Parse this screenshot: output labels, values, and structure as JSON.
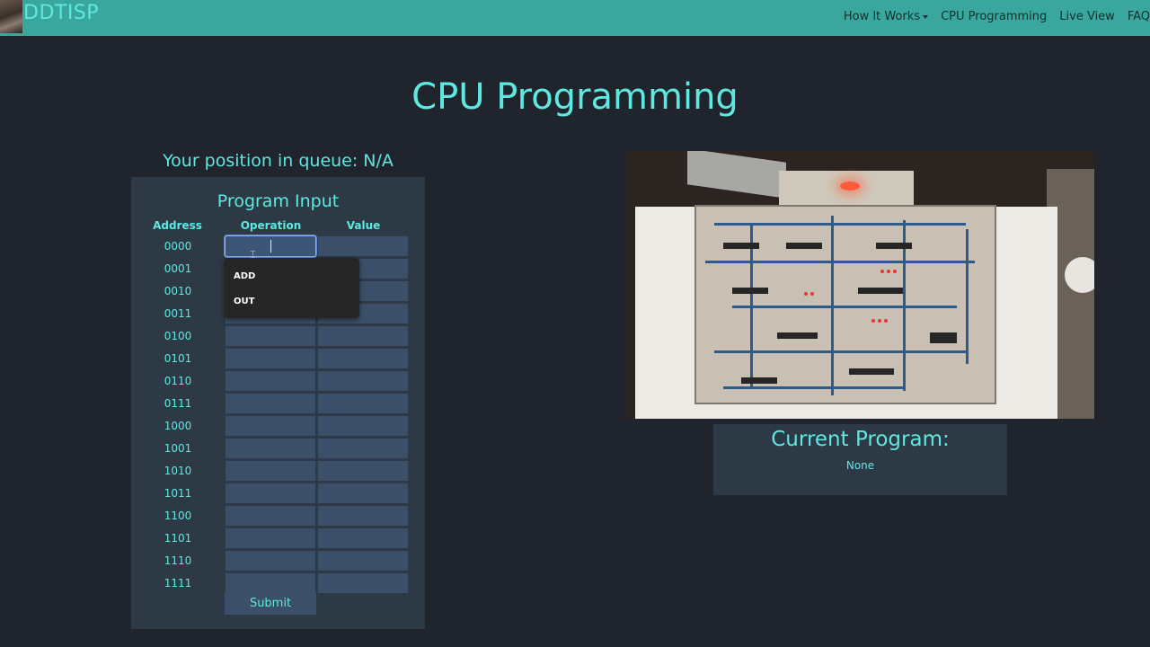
{
  "navbar": {
    "brand": "DDTISP",
    "links": [
      {
        "label": "How It Works",
        "dropdown": true
      },
      {
        "label": "CPU Programming",
        "dropdown": false
      },
      {
        "label": "Live View",
        "dropdown": false
      },
      {
        "label": "FAQ",
        "dropdown": false
      }
    ]
  },
  "page": {
    "title": "CPU Programming",
    "queue_text": "Your position in queue: N/A"
  },
  "program_input": {
    "title": "Program Input",
    "columns": [
      "Address",
      "Operation",
      "Value"
    ],
    "addresses": [
      "0000",
      "0001",
      "0010",
      "0011",
      "0100",
      "0101",
      "0110",
      "0111",
      "1000",
      "1001",
      "1010",
      "1011",
      "1100",
      "1101",
      "1110",
      "1111"
    ],
    "submit_label": "Submit",
    "operation_options": [
      "ADD",
      "OUT"
    ]
  },
  "current_program": {
    "title": "Current Program:",
    "value": "None"
  },
  "colors": {
    "background": "#1f242d",
    "navbar": "#39a79e",
    "accent": "#5fe8e0",
    "panel": "#2e3946",
    "cell": "#3b5068"
  }
}
